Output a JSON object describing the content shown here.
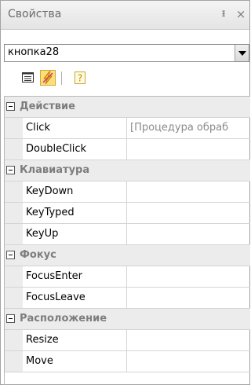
{
  "panel": {
    "title": "Свойства",
    "pin_glyph": "ᵻ",
    "close_glyph": "×"
  },
  "object_selector": {
    "value": "кнопка28"
  },
  "toolbar": {
    "buttons": [
      "list-icon",
      "events-icon",
      "help-icon"
    ],
    "active": "events-icon",
    "active_color": "#fbe07a"
  },
  "categories": [
    {
      "label": "Действие",
      "properties": [
        {
          "name": "Click",
          "value": "[Процедура обраб"
        },
        {
          "name": "DoubleClick",
          "value": ""
        }
      ]
    },
    {
      "label": "Клавиатура",
      "properties": [
        {
          "name": "KeyDown",
          "value": ""
        },
        {
          "name": "KeyTyped",
          "value": ""
        },
        {
          "name": "KeyUp",
          "value": ""
        }
      ]
    },
    {
      "label": "Фокус",
      "properties": [
        {
          "name": "FocusEnter",
          "value": ""
        },
        {
          "name": "FocusLeave",
          "value": ""
        }
      ]
    },
    {
      "label": "Расположение",
      "properties": [
        {
          "name": "Resize",
          "value": ""
        },
        {
          "name": "Move",
          "value": ""
        }
      ]
    }
  ]
}
